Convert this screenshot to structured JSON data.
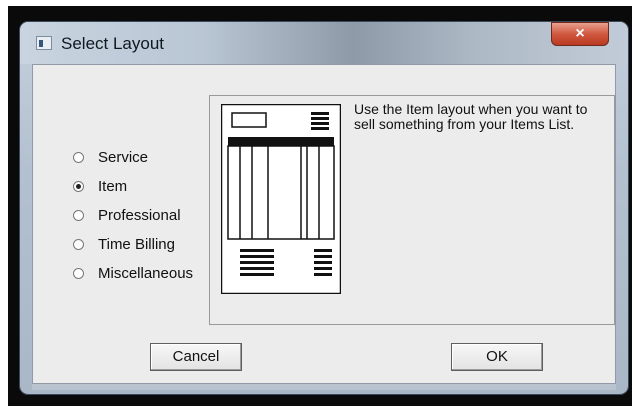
{
  "window": {
    "title": "Select Layout",
    "close_symbol": "×",
    "title_icon": "app-window-icon"
  },
  "layout_options": [
    {
      "label": "Service",
      "selected": false
    },
    {
      "label": "Item",
      "selected": true
    },
    {
      "label": "Professional",
      "selected": false
    },
    {
      "label": "Time Billing",
      "selected": false
    },
    {
      "label": "Miscellaneous",
      "selected": false
    }
  ],
  "preview": {
    "description": "Use the Item layout when you want to sell something from your Items List.",
    "image_icon": "item-layout-preview-icon"
  },
  "buttons": {
    "cancel_label": "Cancel",
    "ok_label": "OK"
  }
}
